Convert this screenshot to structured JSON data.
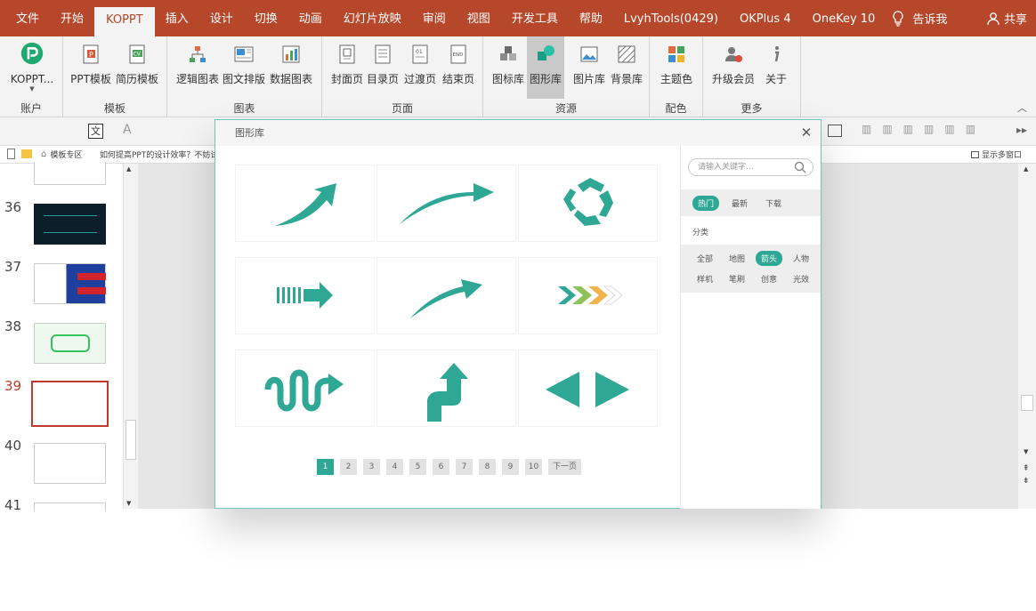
{
  "menu": {
    "tabs": [
      "文件",
      "开始",
      "KOPPT",
      "插入",
      "设计",
      "切换",
      "动画",
      "幻灯片放映",
      "审阅",
      "视图",
      "开发工具",
      "帮助",
      "LvyhTools(0429)",
      "OKPlus 4",
      "OneKey 10"
    ],
    "active_tab": "KOPPT",
    "tell_me": "告诉我",
    "share": "共享"
  },
  "ribbon": {
    "account": {
      "button": "KOPPT...",
      "group": "账户"
    },
    "templates": {
      "buttons": [
        "PPT模板",
        "简历模板"
      ],
      "group": "模板"
    },
    "charts": {
      "buttons": [
        "逻辑图表",
        "图文排版",
        "数据图表"
      ],
      "group": "图表"
    },
    "pages": {
      "buttons": [
        "封面页",
        "目录页",
        "过渡页",
        "结束页"
      ],
      "group": "页面"
    },
    "resources": {
      "buttons": [
        "图标库",
        "图形库",
        "图片库",
        "背景库"
      ],
      "group": "资源"
    },
    "colors": {
      "buttons": [
        "主题色"
      ],
      "group": "配色"
    },
    "more": {
      "buttons": [
        "升级会员",
        "关于"
      ],
      "group": "更多"
    }
  },
  "tabs_row": {
    "home_tab": "模板专区",
    "doc_tab": "如何提高PPT的设计效率？不妨试",
    "multi_window": "显示多窗口"
  },
  "slides": {
    "numbers": [
      "36",
      "37",
      "38",
      "39",
      "40",
      "41"
    ],
    "selected": "39"
  },
  "dialog": {
    "title": "图形库",
    "search_placeholder": "请输入关键字...",
    "sort_tabs": [
      "热门",
      "最新",
      "下载"
    ],
    "active_sort": "热门",
    "category_label": "分类",
    "categories_row1": [
      "全部",
      "地图",
      "箭头",
      "人物"
    ],
    "categories_row2": [
      "样机",
      "笔刷",
      "创意",
      "光效"
    ],
    "active_category": "箭头",
    "pages": [
      "1",
      "2",
      "3",
      "4",
      "5",
      "6",
      "7",
      "8",
      "9",
      "10"
    ],
    "current_page": "1",
    "next_label": "下一页",
    "accent": "#2ea795"
  },
  "colors": {
    "title_bar": "#b7472a",
    "accent": "#2ea795"
  }
}
